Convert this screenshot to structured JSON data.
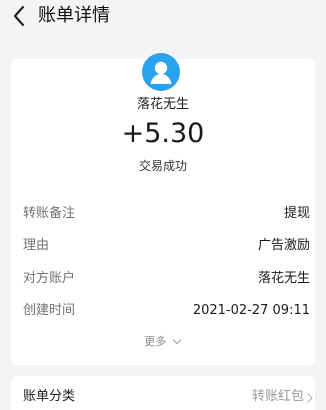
{
  "header": {
    "title": "账单详情",
    "back_icon": "chevron-left-icon"
  },
  "summary": {
    "avatar_icon": "user-avatar-icon",
    "avatar_color": "#2aa3ef",
    "name": "落花无生",
    "amount": "+5.30",
    "status": "交易成功"
  },
  "details": [
    {
      "label": "转账备注",
      "value": "提现"
    },
    {
      "label": "理由",
      "value": "广告激励"
    },
    {
      "label": "对方账户",
      "value": "落花无生"
    },
    {
      "label": "创建时间",
      "value": "2021-02-27 09:11"
    }
  ],
  "more": {
    "label": "更多",
    "icon": "chevron-down-icon"
  },
  "category": {
    "label": "账单分类",
    "value": "转账红包",
    "icon": "chevron-right-icon"
  }
}
